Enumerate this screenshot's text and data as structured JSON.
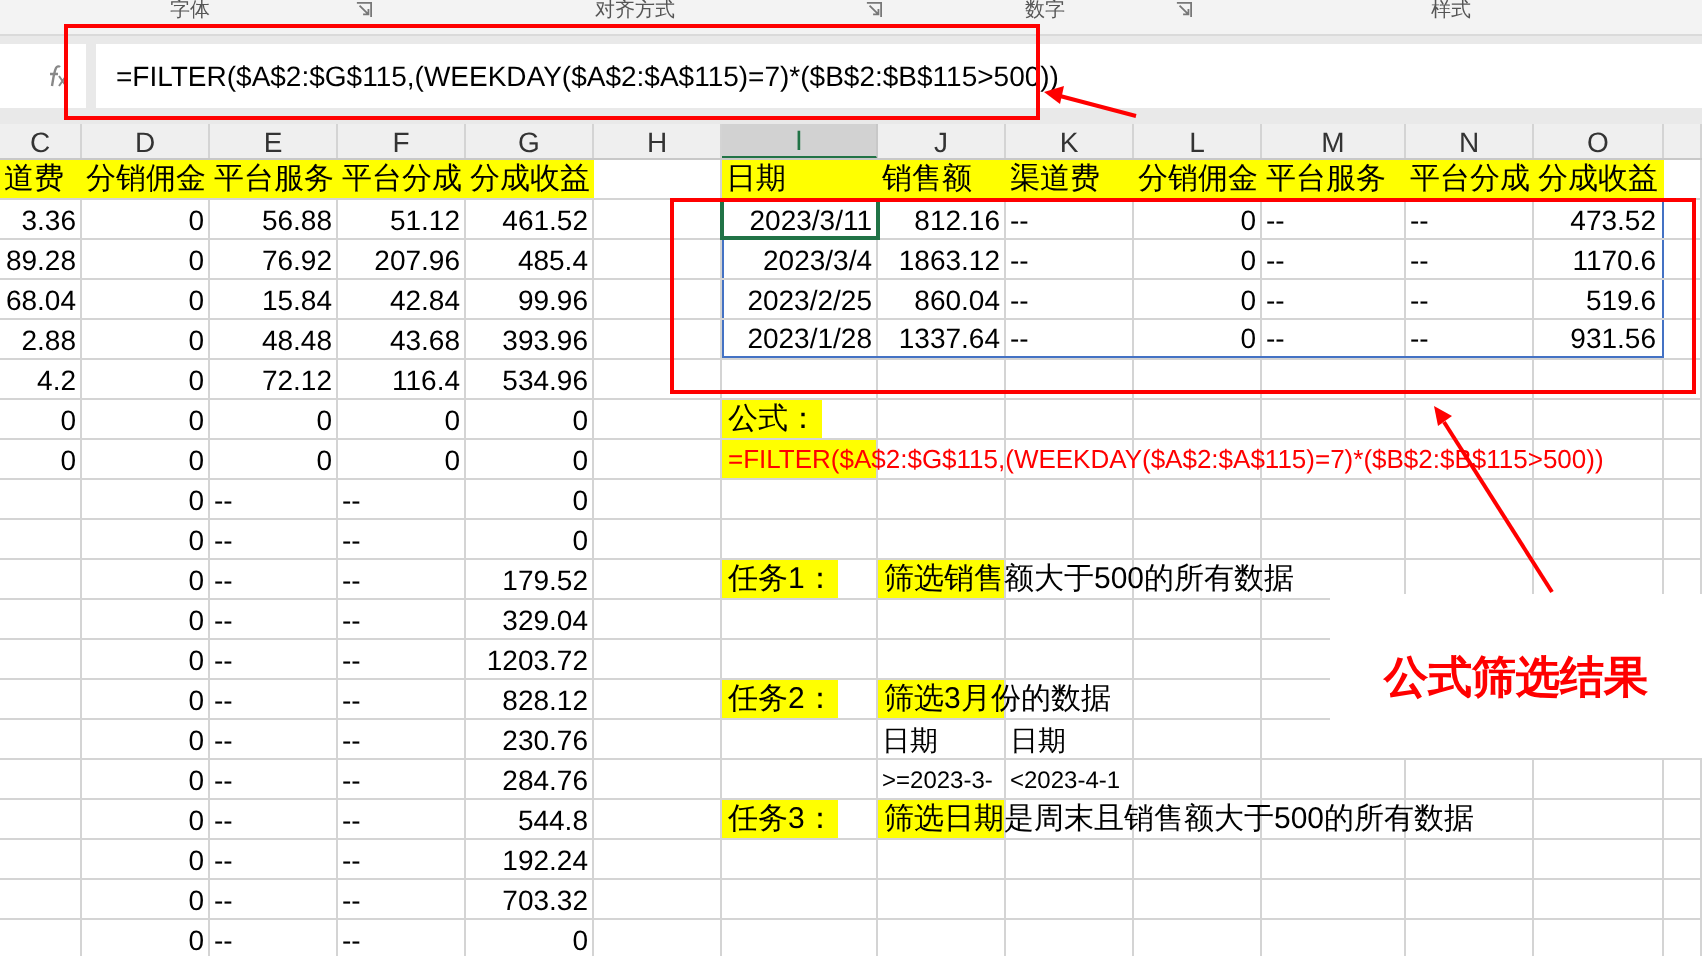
{
  "ribbon": {
    "groups": [
      "字体",
      "对齐方式",
      "数字",
      "样式"
    ]
  },
  "formula_bar": {
    "formula": "=FILTER($A$2:$G$115,(WEEKDAY($A$2:$A$115)=7)*($B$2:$B$115>500))"
  },
  "sheet": {
    "columns": [
      {
        "label": "C",
        "selected": false
      },
      {
        "label": "D",
        "selected": false
      },
      {
        "label": "E",
        "selected": false
      },
      {
        "label": "F",
        "selected": false
      },
      {
        "label": "G",
        "selected": false
      },
      {
        "label": "H",
        "selected": false
      },
      {
        "label": "I",
        "selected": true
      },
      {
        "label": "J",
        "selected": false
      },
      {
        "label": "K",
        "selected": false
      },
      {
        "label": "L",
        "selected": false
      },
      {
        "label": "M",
        "selected": false
      },
      {
        "label": "N",
        "selected": false
      },
      {
        "label": "O",
        "selected": false
      }
    ],
    "rows": [
      {
        "spill": false,
        "cells": [
          {
            "text": "道费",
            "kind": "header",
            "selected": false
          },
          {
            "text": "分销佣金",
            "kind": "header",
            "selected": false
          },
          {
            "text": "平台服务",
            "kind": "header",
            "selected": false
          },
          {
            "text": "平台分成",
            "kind": "header",
            "selected": false
          },
          {
            "text": "分成收益",
            "kind": "header",
            "selected": false
          },
          null,
          {
            "text": "日期",
            "kind": "header",
            "selected": false
          },
          {
            "text": "销售额",
            "kind": "header",
            "selected": false
          },
          {
            "text": "渠道费",
            "kind": "header",
            "selected": false
          },
          {
            "text": "分销佣金",
            "kind": "header",
            "selected": false
          },
          {
            "text": "平台服务",
            "kind": "header",
            "selected": false
          },
          {
            "text": "平台分成",
            "kind": "header",
            "selected": false
          },
          {
            "text": "分成收益",
            "kind": "header",
            "selected": false
          }
        ]
      },
      {
        "spill": true,
        "cells": [
          {
            "text": "3.36",
            "kind": "number",
            "selected": false
          },
          {
            "text": "0",
            "kind": "number",
            "selected": false
          },
          {
            "text": "56.88",
            "kind": "number",
            "selected": false
          },
          {
            "text": "51.12",
            "kind": "number",
            "selected": false
          },
          {
            "text": "461.52",
            "kind": "number",
            "selected": false
          },
          null,
          {
            "text": "2023/3/11",
            "kind": "number",
            "selected": true
          },
          {
            "text": "812.16",
            "kind": "number",
            "selected": false
          },
          {
            "text": "--",
            "kind": "text",
            "selected": false
          },
          {
            "text": "0",
            "kind": "number",
            "selected": false
          },
          {
            "text": "--",
            "kind": "text",
            "selected": false
          },
          {
            "text": "--",
            "kind": "text",
            "selected": false
          },
          {
            "text": "473.52",
            "kind": "number",
            "selected": false
          }
        ]
      },
      {
        "spill": true,
        "cells": [
          {
            "text": "89.28",
            "kind": "number",
            "selected": false
          },
          {
            "text": "0",
            "kind": "number",
            "selected": false
          },
          {
            "text": "76.92",
            "kind": "number",
            "selected": false
          },
          {
            "text": "207.96",
            "kind": "number",
            "selected": false
          },
          {
            "text": "485.4",
            "kind": "number",
            "selected": false
          },
          null,
          {
            "text": "2023/3/4",
            "kind": "number",
            "selected": false
          },
          {
            "text": "1863.12",
            "kind": "number",
            "selected": false
          },
          {
            "text": "--",
            "kind": "text",
            "selected": false
          },
          {
            "text": "0",
            "kind": "number",
            "selected": false
          },
          {
            "text": "--",
            "kind": "text",
            "selected": false
          },
          {
            "text": "--",
            "kind": "text",
            "selected": false
          },
          {
            "text": "1170.6",
            "kind": "number",
            "selected": false
          }
        ]
      },
      {
        "spill": true,
        "cells": [
          {
            "text": "68.04",
            "kind": "number",
            "selected": false
          },
          {
            "text": "0",
            "kind": "number",
            "selected": false
          },
          {
            "text": "15.84",
            "kind": "number",
            "selected": false
          },
          {
            "text": "42.84",
            "kind": "number",
            "selected": false
          },
          {
            "text": "99.96",
            "kind": "number",
            "selected": false
          },
          null,
          {
            "text": "2023/2/25",
            "kind": "number",
            "selected": false
          },
          {
            "text": "860.04",
            "kind": "number",
            "selected": false
          },
          {
            "text": "--",
            "kind": "text",
            "selected": false
          },
          {
            "text": "0",
            "kind": "number",
            "selected": false
          },
          {
            "text": "--",
            "kind": "text",
            "selected": false
          },
          {
            "text": "--",
            "kind": "text",
            "selected": false
          },
          {
            "text": "519.6",
            "kind": "number",
            "selected": false
          }
        ]
      },
      {
        "spill": true,
        "cells": [
          {
            "text": "2.88",
            "kind": "number",
            "selected": false
          },
          {
            "text": "0",
            "kind": "number",
            "selected": false
          },
          {
            "text": "48.48",
            "kind": "number",
            "selected": false
          },
          {
            "text": "43.68",
            "kind": "number",
            "selected": false
          },
          {
            "text": "393.96",
            "kind": "number",
            "selected": false
          },
          null,
          {
            "text": "2023/1/28",
            "kind": "number",
            "selected": false
          },
          {
            "text": "1337.64",
            "kind": "number",
            "selected": false
          },
          {
            "text": "--",
            "kind": "text",
            "selected": false
          },
          {
            "text": "0",
            "kind": "number",
            "selected": false
          },
          {
            "text": "--",
            "kind": "text",
            "selected": false
          },
          {
            "text": "--",
            "kind": "text",
            "selected": false
          },
          {
            "text": "931.56",
            "kind": "number",
            "selected": false
          }
        ]
      },
      {
        "spill": false,
        "cells": [
          {
            "text": "4.2",
            "kind": "number",
            "selected": false
          },
          {
            "text": "0",
            "kind": "number",
            "selected": false
          },
          {
            "text": "72.12",
            "kind": "number",
            "selected": false
          },
          {
            "text": "116.4",
            "kind": "number",
            "selected": false
          },
          {
            "text": "534.96",
            "kind": "number",
            "selected": false
          }
        ]
      },
      {
        "spill": false,
        "cells": [
          {
            "text": "0",
            "kind": "number",
            "selected": false
          },
          {
            "text": "0",
            "kind": "number",
            "selected": false
          },
          {
            "text": "0",
            "kind": "number",
            "selected": false
          },
          {
            "text": "0",
            "kind": "number",
            "selected": false
          },
          {
            "text": "0",
            "kind": "number",
            "selected": false
          },
          null,
          {
            "text": "公式：",
            "kind": "label",
            "selected": false
          }
        ]
      },
      {
        "spill": false,
        "cells": [
          {
            "text": "0",
            "kind": "number",
            "selected": false
          },
          {
            "text": "0",
            "kind": "number",
            "selected": false
          },
          {
            "text": "0",
            "kind": "number",
            "selected": false
          },
          {
            "text": "0",
            "kind": "number",
            "selected": false
          },
          {
            "text": "0",
            "kind": "number",
            "selected": false
          },
          null,
          {
            "text": "=FILTER($A$2:$G$115,(WEEKDAY($A$2:$A$115)=7)*($B$2:$B$115>500))",
            "kind": "formula",
            "selected": false
          }
        ]
      },
      {
        "spill": false,
        "cells": [
          null,
          {
            "text": "0",
            "kind": "number",
            "selected": false
          },
          {
            "text": "--",
            "kind": "text",
            "selected": false
          },
          {
            "text": "--",
            "kind": "text",
            "selected": false
          },
          {
            "text": "0",
            "kind": "number",
            "selected": false
          }
        ]
      },
      {
        "spill": false,
        "cells": [
          null,
          {
            "text": "0",
            "kind": "number",
            "selected": false
          },
          {
            "text": "--",
            "kind": "text",
            "selected": false
          },
          {
            "text": "--",
            "kind": "text",
            "selected": false
          },
          {
            "text": "0",
            "kind": "number",
            "selected": false
          }
        ]
      },
      {
        "spill": false,
        "cells": [
          null,
          {
            "text": "0",
            "kind": "number",
            "selected": false
          },
          {
            "text": "--",
            "kind": "text",
            "selected": false
          },
          {
            "text": "--",
            "kind": "text",
            "selected": false
          },
          {
            "text": "179.52",
            "kind": "number",
            "selected": false
          },
          null,
          {
            "text": "任务1：",
            "kind": "label",
            "selected": false
          },
          {
            "text": "筛选销售额大于500的所有数据",
            "kind": "label",
            "selected": false
          }
        ]
      },
      {
        "spill": false,
        "cells": [
          null,
          {
            "text": "0",
            "kind": "number",
            "selected": false
          },
          {
            "text": "--",
            "kind": "text",
            "selected": false
          },
          {
            "text": "--",
            "kind": "text",
            "selected": false
          },
          {
            "text": "329.04",
            "kind": "number",
            "selected": false
          }
        ]
      },
      {
        "spill": false,
        "cells": [
          null,
          {
            "text": "0",
            "kind": "number",
            "selected": false
          },
          {
            "text": "--",
            "kind": "text",
            "selected": false
          },
          {
            "text": "--",
            "kind": "text",
            "selected": false
          },
          {
            "text": "1203.72",
            "kind": "number",
            "selected": false
          }
        ]
      },
      {
        "spill": false,
        "cells": [
          null,
          {
            "text": "0",
            "kind": "number",
            "selected": false
          },
          {
            "text": "--",
            "kind": "text",
            "selected": false
          },
          {
            "text": "--",
            "kind": "text",
            "selected": false
          },
          {
            "text": "828.12",
            "kind": "number",
            "selected": false
          },
          null,
          {
            "text": "任务2：",
            "kind": "label",
            "selected": false
          },
          {
            "text": "筛选3月份的数据",
            "kind": "label",
            "selected": false
          }
        ]
      },
      {
        "spill": false,
        "cells": [
          null,
          {
            "text": "0",
            "kind": "number",
            "selected": false
          },
          {
            "text": "--",
            "kind": "text",
            "selected": false
          },
          {
            "text": "--",
            "kind": "text",
            "selected": false
          },
          {
            "text": "230.76",
            "kind": "number",
            "selected": false
          },
          null,
          null,
          {
            "text": "日期",
            "kind": "text",
            "selected": false
          },
          {
            "text": "日期",
            "kind": "text",
            "selected": false
          }
        ]
      },
      {
        "spill": false,
        "cells": [
          null,
          {
            "text": "0",
            "kind": "number",
            "selected": false
          },
          {
            "text": "--",
            "kind": "text",
            "selected": false
          },
          {
            "text": "--",
            "kind": "text",
            "selected": false
          },
          {
            "text": "284.76",
            "kind": "number",
            "selected": false
          },
          null,
          null,
          {
            "text": ">=2023-3-",
            "kind": "small",
            "selected": false
          },
          {
            "text": "<2023-4-1",
            "kind": "small",
            "selected": false
          }
        ]
      },
      {
        "spill": false,
        "cells": [
          null,
          {
            "text": "0",
            "kind": "number",
            "selected": false
          },
          {
            "text": "--",
            "kind": "text",
            "selected": false
          },
          {
            "text": "--",
            "kind": "text",
            "selected": false
          },
          {
            "text": "544.8",
            "kind": "number",
            "selected": false
          },
          null,
          {
            "text": "任务3：",
            "kind": "label",
            "selected": false
          },
          {
            "text": "筛选日期是周末且销售额大于500的所有数据",
            "kind": "label",
            "selected": false
          }
        ]
      },
      {
        "spill": false,
        "cells": [
          null,
          {
            "text": "0",
            "kind": "number",
            "selected": false
          },
          {
            "text": "--",
            "kind": "text",
            "selected": false
          },
          {
            "text": "--",
            "kind": "text",
            "selected": false
          },
          {
            "text": "192.24",
            "kind": "number",
            "selected": false
          }
        ]
      },
      {
        "spill": false,
        "cells": [
          null,
          {
            "text": "0",
            "kind": "number",
            "selected": false
          },
          {
            "text": "--",
            "kind": "text",
            "selected": false
          },
          {
            "text": "--",
            "kind": "text",
            "selected": false
          },
          {
            "text": "703.32",
            "kind": "number",
            "selected": false
          }
        ]
      },
      {
        "spill": false,
        "cells": [
          null,
          {
            "text": "0",
            "kind": "number",
            "selected": false
          },
          {
            "text": "--",
            "kind": "text",
            "selected": false
          },
          {
            "text": "--",
            "kind": "text",
            "selected": false
          },
          {
            "text": "0",
            "kind": "number",
            "selected": false
          }
        ]
      }
    ]
  },
  "annotation": {
    "text": "公式筛选结果"
  }
}
